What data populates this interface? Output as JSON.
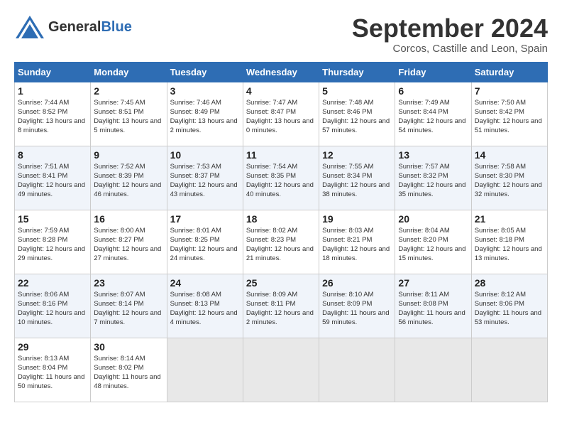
{
  "header": {
    "logo_general": "General",
    "logo_blue": "Blue",
    "month": "September 2024",
    "location": "Corcos, Castille and Leon, Spain"
  },
  "weekdays": [
    "Sunday",
    "Monday",
    "Tuesday",
    "Wednesday",
    "Thursday",
    "Friday",
    "Saturday"
  ],
  "weeks": [
    [
      {
        "day": "1",
        "sunrise": "7:44 AM",
        "sunset": "8:52 PM",
        "daylight": "13 hours and 8 minutes."
      },
      {
        "day": "2",
        "sunrise": "7:45 AM",
        "sunset": "8:51 PM",
        "daylight": "13 hours and 5 minutes."
      },
      {
        "day": "3",
        "sunrise": "7:46 AM",
        "sunset": "8:49 PM",
        "daylight": "13 hours and 2 minutes."
      },
      {
        "day": "4",
        "sunrise": "7:47 AM",
        "sunset": "8:47 PM",
        "daylight": "13 hours and 0 minutes."
      },
      {
        "day": "5",
        "sunrise": "7:48 AM",
        "sunset": "8:46 PM",
        "daylight": "12 hours and 57 minutes."
      },
      {
        "day": "6",
        "sunrise": "7:49 AM",
        "sunset": "8:44 PM",
        "daylight": "12 hours and 54 minutes."
      },
      {
        "day": "7",
        "sunrise": "7:50 AM",
        "sunset": "8:42 PM",
        "daylight": "12 hours and 51 minutes."
      }
    ],
    [
      {
        "day": "8",
        "sunrise": "7:51 AM",
        "sunset": "8:41 PM",
        "daylight": "12 hours and 49 minutes."
      },
      {
        "day": "9",
        "sunrise": "7:52 AM",
        "sunset": "8:39 PM",
        "daylight": "12 hours and 46 minutes."
      },
      {
        "day": "10",
        "sunrise": "7:53 AM",
        "sunset": "8:37 PM",
        "daylight": "12 hours and 43 minutes."
      },
      {
        "day": "11",
        "sunrise": "7:54 AM",
        "sunset": "8:35 PM",
        "daylight": "12 hours and 40 minutes."
      },
      {
        "day": "12",
        "sunrise": "7:55 AM",
        "sunset": "8:34 PM",
        "daylight": "12 hours and 38 minutes."
      },
      {
        "day": "13",
        "sunrise": "7:57 AM",
        "sunset": "8:32 PM",
        "daylight": "12 hours and 35 minutes."
      },
      {
        "day": "14",
        "sunrise": "7:58 AM",
        "sunset": "8:30 PM",
        "daylight": "12 hours and 32 minutes."
      }
    ],
    [
      {
        "day": "15",
        "sunrise": "7:59 AM",
        "sunset": "8:28 PM",
        "daylight": "12 hours and 29 minutes."
      },
      {
        "day": "16",
        "sunrise": "8:00 AM",
        "sunset": "8:27 PM",
        "daylight": "12 hours and 27 minutes."
      },
      {
        "day": "17",
        "sunrise": "8:01 AM",
        "sunset": "8:25 PM",
        "daylight": "12 hours and 24 minutes."
      },
      {
        "day": "18",
        "sunrise": "8:02 AM",
        "sunset": "8:23 PM",
        "daylight": "12 hours and 21 minutes."
      },
      {
        "day": "19",
        "sunrise": "8:03 AM",
        "sunset": "8:21 PM",
        "daylight": "12 hours and 18 minutes."
      },
      {
        "day": "20",
        "sunrise": "8:04 AM",
        "sunset": "8:20 PM",
        "daylight": "12 hours and 15 minutes."
      },
      {
        "day": "21",
        "sunrise": "8:05 AM",
        "sunset": "8:18 PM",
        "daylight": "12 hours and 13 minutes."
      }
    ],
    [
      {
        "day": "22",
        "sunrise": "8:06 AM",
        "sunset": "8:16 PM",
        "daylight": "12 hours and 10 minutes."
      },
      {
        "day": "23",
        "sunrise": "8:07 AM",
        "sunset": "8:14 PM",
        "daylight": "12 hours and 7 minutes."
      },
      {
        "day": "24",
        "sunrise": "8:08 AM",
        "sunset": "8:13 PM",
        "daylight": "12 hours and 4 minutes."
      },
      {
        "day": "25",
        "sunrise": "8:09 AM",
        "sunset": "8:11 PM",
        "daylight": "12 hours and 2 minutes."
      },
      {
        "day": "26",
        "sunrise": "8:10 AM",
        "sunset": "8:09 PM",
        "daylight": "11 hours and 59 minutes."
      },
      {
        "day": "27",
        "sunrise": "8:11 AM",
        "sunset": "8:08 PM",
        "daylight": "11 hours and 56 minutes."
      },
      {
        "day": "28",
        "sunrise": "8:12 AM",
        "sunset": "8:06 PM",
        "daylight": "11 hours and 53 minutes."
      }
    ],
    [
      {
        "day": "29",
        "sunrise": "8:13 AM",
        "sunset": "8:04 PM",
        "daylight": "11 hours and 50 minutes."
      },
      {
        "day": "30",
        "sunrise": "8:14 AM",
        "sunset": "8:02 PM",
        "daylight": "11 hours and 48 minutes."
      },
      {
        "day": "",
        "sunrise": "",
        "sunset": "",
        "daylight": ""
      },
      {
        "day": "",
        "sunrise": "",
        "sunset": "",
        "daylight": ""
      },
      {
        "day": "",
        "sunrise": "",
        "sunset": "",
        "daylight": ""
      },
      {
        "day": "",
        "sunrise": "",
        "sunset": "",
        "daylight": ""
      },
      {
        "day": "",
        "sunrise": "",
        "sunset": "",
        "daylight": ""
      }
    ]
  ]
}
